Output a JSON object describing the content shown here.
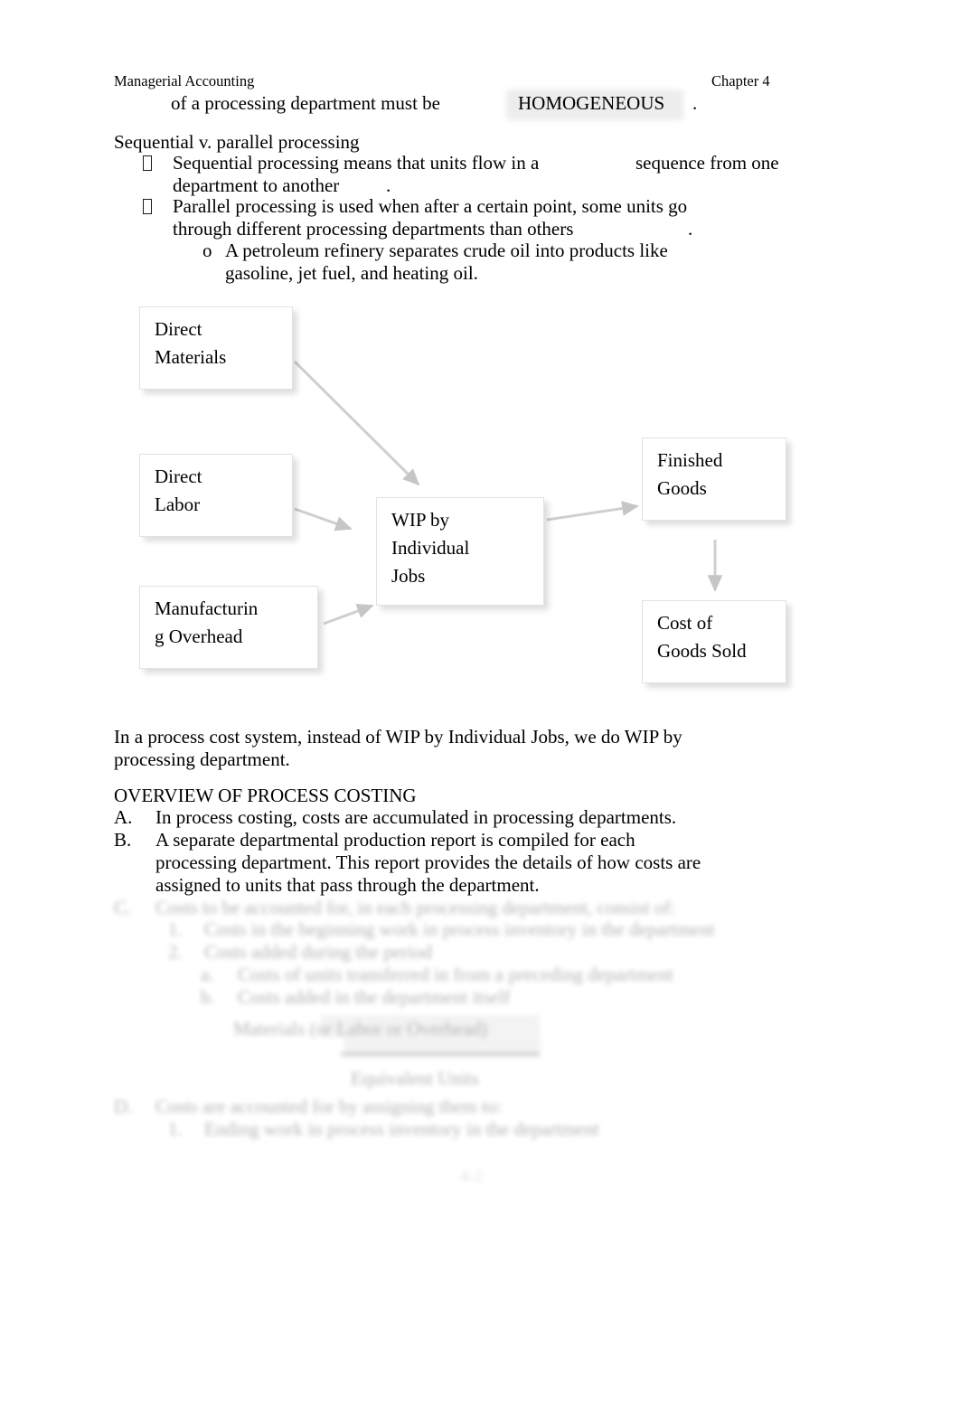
{
  "document": {
    "header": {
      "left": "Managerial Accounting",
      "right": "Chapter 4"
    },
    "page_number": "4-2"
  },
  "body": {
    "continued_line": {
      "text": "of a processing department must be",
      "blank_answer": "HOMOGENEOUS",
      "period": "."
    },
    "section_heading": "Sequential v. parallel processing",
    "bullets": [
      {
        "marker": "bullet-tofu",
        "line1_a": "Sequential processing means that units flow in a",
        "line1_b": "sequence from one",
        "line2_a": "department to another",
        "line2_b": "."
      },
      {
        "marker": "bullet-tofu",
        "line1": "Parallel processing is used when after a certain point, some units go",
        "line2_a": "through different processing departments than others",
        "line2_b": ".",
        "sub": {
          "marker": "o",
          "line1": "A petroleum refinery separates crude oil into products like",
          "line2": "gasoline, jet fuel, and heating oil."
        }
      }
    ],
    "after_diagram": {
      "line1": "In a process cost system, instead of WIP by Individual Jobs, we do WIP by",
      "line2": "processing department."
    },
    "overview": {
      "title": "OVERVIEW OF PROCESS COSTING",
      "items": [
        {
          "marker": "A.",
          "lines": [
            "In process costing, costs are accumulated in processing departments."
          ]
        },
        {
          "marker": "B.",
          "lines": [
            "A separate departmental production report is compiled for each",
            "processing department. This report provides the details of how costs are",
            "assigned to units that pass through the department."
          ]
        }
      ]
    },
    "faded": {
      "items": [
        {
          "marker": "C.",
          "lines": [
            "Costs to be accounted for, in each processing department, consist of:"
          ],
          "sub": [
            {
              "marker": "1.",
              "text": "Costs in the beginning work in process inventory in the department"
            },
            {
              "marker": "2.",
              "text": "Costs added during the period",
              "subsub": [
                {
                  "marker": "a.",
                  "text": "Costs of units transferred in from a preceding department"
                },
                {
                  "marker": "b.",
                  "text": "Costs added in the department itself"
                }
              ]
            }
          ],
          "formula": {
            "numerator": "Materials (or Labor or Overhead)",
            "denominator": "Equivalent Units"
          }
        },
        {
          "marker": "D.",
          "lines": [
            "Costs are accounted for by assigning them to:"
          ],
          "sub": [
            {
              "marker": "1.",
              "text": "Ending work in process inventory in the department"
            }
          ]
        }
      ]
    }
  },
  "diagram": {
    "name": "job-order-cost-flow-diagram",
    "nodes": [
      {
        "id": "direct-materials",
        "label_line1": "Direct",
        "label_line2": "Materials"
      },
      {
        "id": "direct-labor",
        "label_line1": "Direct",
        "label_line2": "Labor"
      },
      {
        "id": "manufacturing-overhead",
        "label_line1": "Manufacturin",
        "label_line2": "g Overhead"
      },
      {
        "id": "wip-by-individual-jobs",
        "label_line1": "WIP by",
        "label_line2": "Individual",
        "label_line3": "Jobs"
      },
      {
        "id": "finished-goods",
        "label_line1": "Finished",
        "label_line2": "Goods"
      },
      {
        "id": "cost-of-goods-sold",
        "label_line1": "Cost of",
        "label_line2": "Goods Sold"
      }
    ],
    "edges": [
      {
        "from": "direct-materials",
        "to": "wip-by-individual-jobs"
      },
      {
        "from": "direct-labor",
        "to": "wip-by-individual-jobs"
      },
      {
        "from": "manufacturing-overhead",
        "to": "wip-by-individual-jobs"
      },
      {
        "from": "wip-by-individual-jobs",
        "to": "finished-goods"
      },
      {
        "from": "finished-goods",
        "to": "cost-of-goods-sold"
      }
    ]
  },
  "colors": {
    "page_background": "#ffffff",
    "text": "#000000",
    "node_border": "#e2e2e2",
    "connector": "#cfcfcf",
    "highlight_smear": "#ededed"
  }
}
